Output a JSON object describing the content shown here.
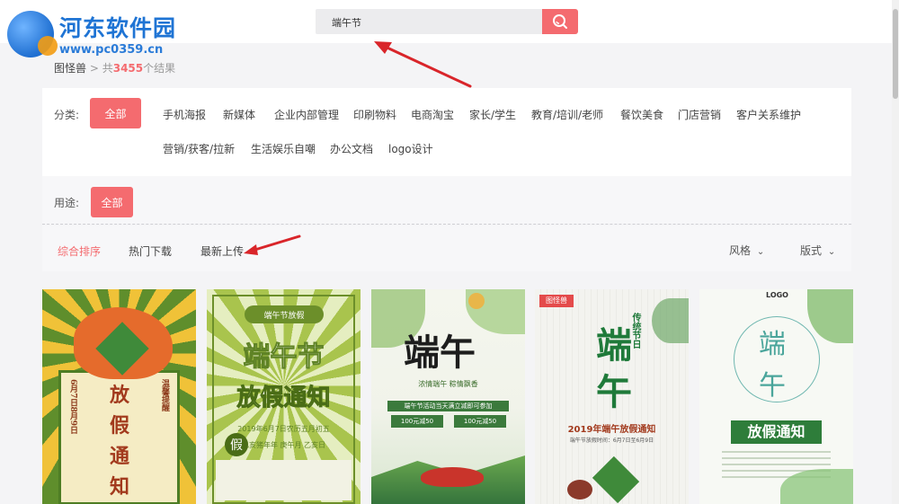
{
  "site": {
    "logo_title": "河东软件园",
    "logo_url": "www.pc0359.cn"
  },
  "search": {
    "query": "端午节",
    "button_icon": "search-icon"
  },
  "breadcrumb": {
    "home": "图怪兽",
    "sep": " > ",
    "prefix": "共",
    "count": "3455",
    "suffix": "个结果"
  },
  "filters": {
    "category_label": "分类:",
    "category_all": "全部",
    "categories": [
      "手机海报",
      "新媒体",
      "企业内部管理",
      "印刷物料",
      "电商淘宝",
      "家长/学生",
      "教育/培训/老师",
      "餐饮美食",
      "门店营销",
      "客户关系维护",
      "营销/获客/拉新",
      "生活娱乐自嘲",
      "办公文档",
      "logo设计"
    ],
    "usage_label": "用途:",
    "usage_all": "全部"
  },
  "sort": {
    "options": [
      "综合排序",
      "热门下载",
      "最新上传"
    ],
    "active_index": 0,
    "style_label": "风格",
    "format_label": "版式"
  },
  "cards": [
    {
      "texts": [
        "放",
        "假",
        "通",
        "知"
      ],
      "side_left": "6月7日8月9日",
      "side_right": "温馨提醒"
    },
    {
      "header": "端午节放假",
      "title1": "端午节",
      "title2": "放假通知",
      "date_line": "2019年6月7日农历五月初五",
      "sub": "己亥猪年年 庚午月 乙亥日",
      "badge": "假"
    },
    {
      "title": "端午",
      "line1": "浓情端午 粽情飘香",
      "tag1": "100元减50",
      "tag2": "100元减50",
      "bar": "端午节活动当天满立减即可参加"
    },
    {
      "logo": "图怪兽",
      "title1": "端",
      "title2": "午",
      "side": "传统节日",
      "date_line": "2019年端午放假通知",
      "sub": "端午节放假时间：6月7日至6月9日"
    },
    {
      "logo": "LOGO",
      "title1": "端",
      "title2": "午",
      "banner": "放假通知"
    }
  ],
  "colors": {
    "accent": "#f46b6f",
    "brand_blue": "#1f74d4",
    "arrow_red": "#d9252a"
  }
}
